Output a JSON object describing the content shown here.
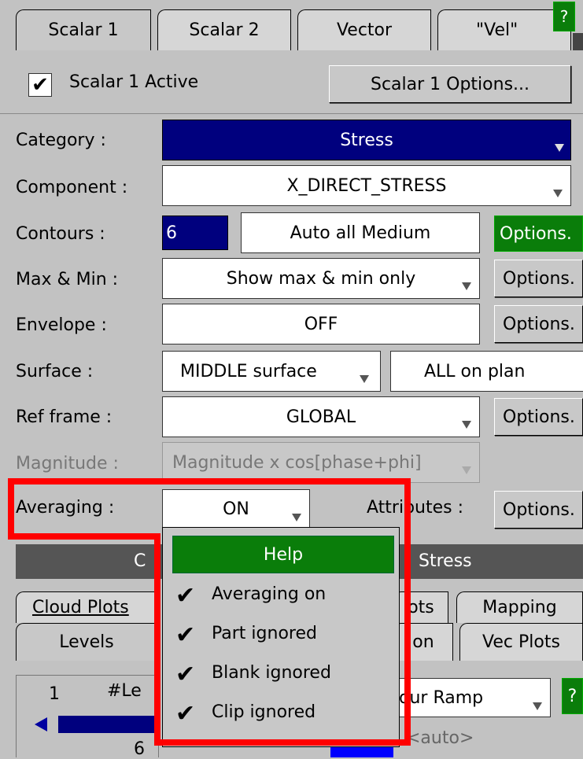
{
  "tabs": [
    "Scalar 1",
    "Scalar 2",
    "Vector",
    "\"Vel\""
  ],
  "help_q": "?",
  "active_checkbox": {
    "checked": true,
    "label": "Scalar 1 Active"
  },
  "options_button": "Scalar 1 Options...",
  "rows": {
    "category": {
      "label": "Category :",
      "value": "Stress"
    },
    "component": {
      "label": "Component :",
      "value": "X_DIRECT_STRESS"
    },
    "contours": {
      "label": "Contours :",
      "count": "6",
      "mode": "Auto all Medium",
      "options": "Options."
    },
    "maxmin": {
      "label": "Max & Min :",
      "value": "Show max & min only",
      "options": "Options."
    },
    "envelope": {
      "label": "Envelope :",
      "value": "OFF",
      "options": "Options."
    },
    "surface": {
      "label": "Surface :",
      "value": "MIDDLE surface",
      "value2": "ALL on plan"
    },
    "refframe": {
      "label": "Ref frame :",
      "value": "GLOBAL",
      "options": "Options."
    },
    "magnitude": {
      "label": "Magnitude :",
      "value": "Magnitude x cos[phase+phi]"
    },
    "averaging": {
      "label": "Averaging :",
      "value": "ON",
      "attributes": "Attributes :",
      "options": "Options."
    }
  },
  "bottom": {
    "bar_left": "C",
    "bar_right": "Stress",
    "tabs_row1": [
      "Cloud Plots",
      "ots",
      "Mapping"
    ],
    "tabs_row2": [
      "Levels",
      "on",
      "Vec Plots"
    ],
    "level_num": "1",
    "level_label": "#Le",
    "level_six": "6",
    "ramp": "our Ramp",
    "auto": "<auto>",
    "q": "?"
  },
  "popup": {
    "header": "Help",
    "items": [
      "Averaging on",
      "Part ignored",
      "Blank ignored",
      "Clip ignored"
    ]
  }
}
